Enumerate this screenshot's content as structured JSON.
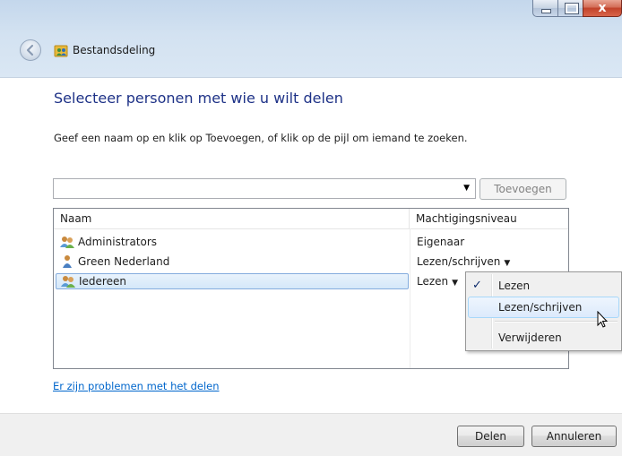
{
  "window": {
    "title": "Bestandsdeling",
    "caption_close_glyph": "x"
  },
  "main": {
    "heading": "Selecteer personen met wie u wilt delen",
    "instructions": "Geef een naam op en klik op Toevoegen, of klik op de pijl om iemand te zoeken.",
    "name_input": {
      "value": "",
      "placeholder": ""
    },
    "add_button": "Toevoegen"
  },
  "list": {
    "columns": {
      "name": "Naam",
      "permission": "Machtigingsniveau"
    },
    "rows": [
      {
        "name": "Administrators",
        "permission": "Eigenaar",
        "icon": "group-icon"
      },
      {
        "name": "Green Nederland",
        "permission": "Lezen/schrijven",
        "icon": "user-icon"
      },
      {
        "name": "Iedereen",
        "permission": "Lezen",
        "icon": "group-icon",
        "selected": true
      }
    ]
  },
  "menu": {
    "items": [
      {
        "label": "Lezen",
        "checked": true
      },
      {
        "label": "Lezen/schrijven",
        "hover": true
      },
      {
        "label": "Verwijderen"
      }
    ],
    "check_glyph": "✓"
  },
  "help_link": "Er zijn problemen met het delen",
  "footer": {
    "share_button": "Delen",
    "cancel_button": "Annuleren"
  },
  "colors": {
    "heading": "#1e3287",
    "link": "#0066cc",
    "selection_border": "#84acdd",
    "titlebar": "#c4d7ec"
  }
}
